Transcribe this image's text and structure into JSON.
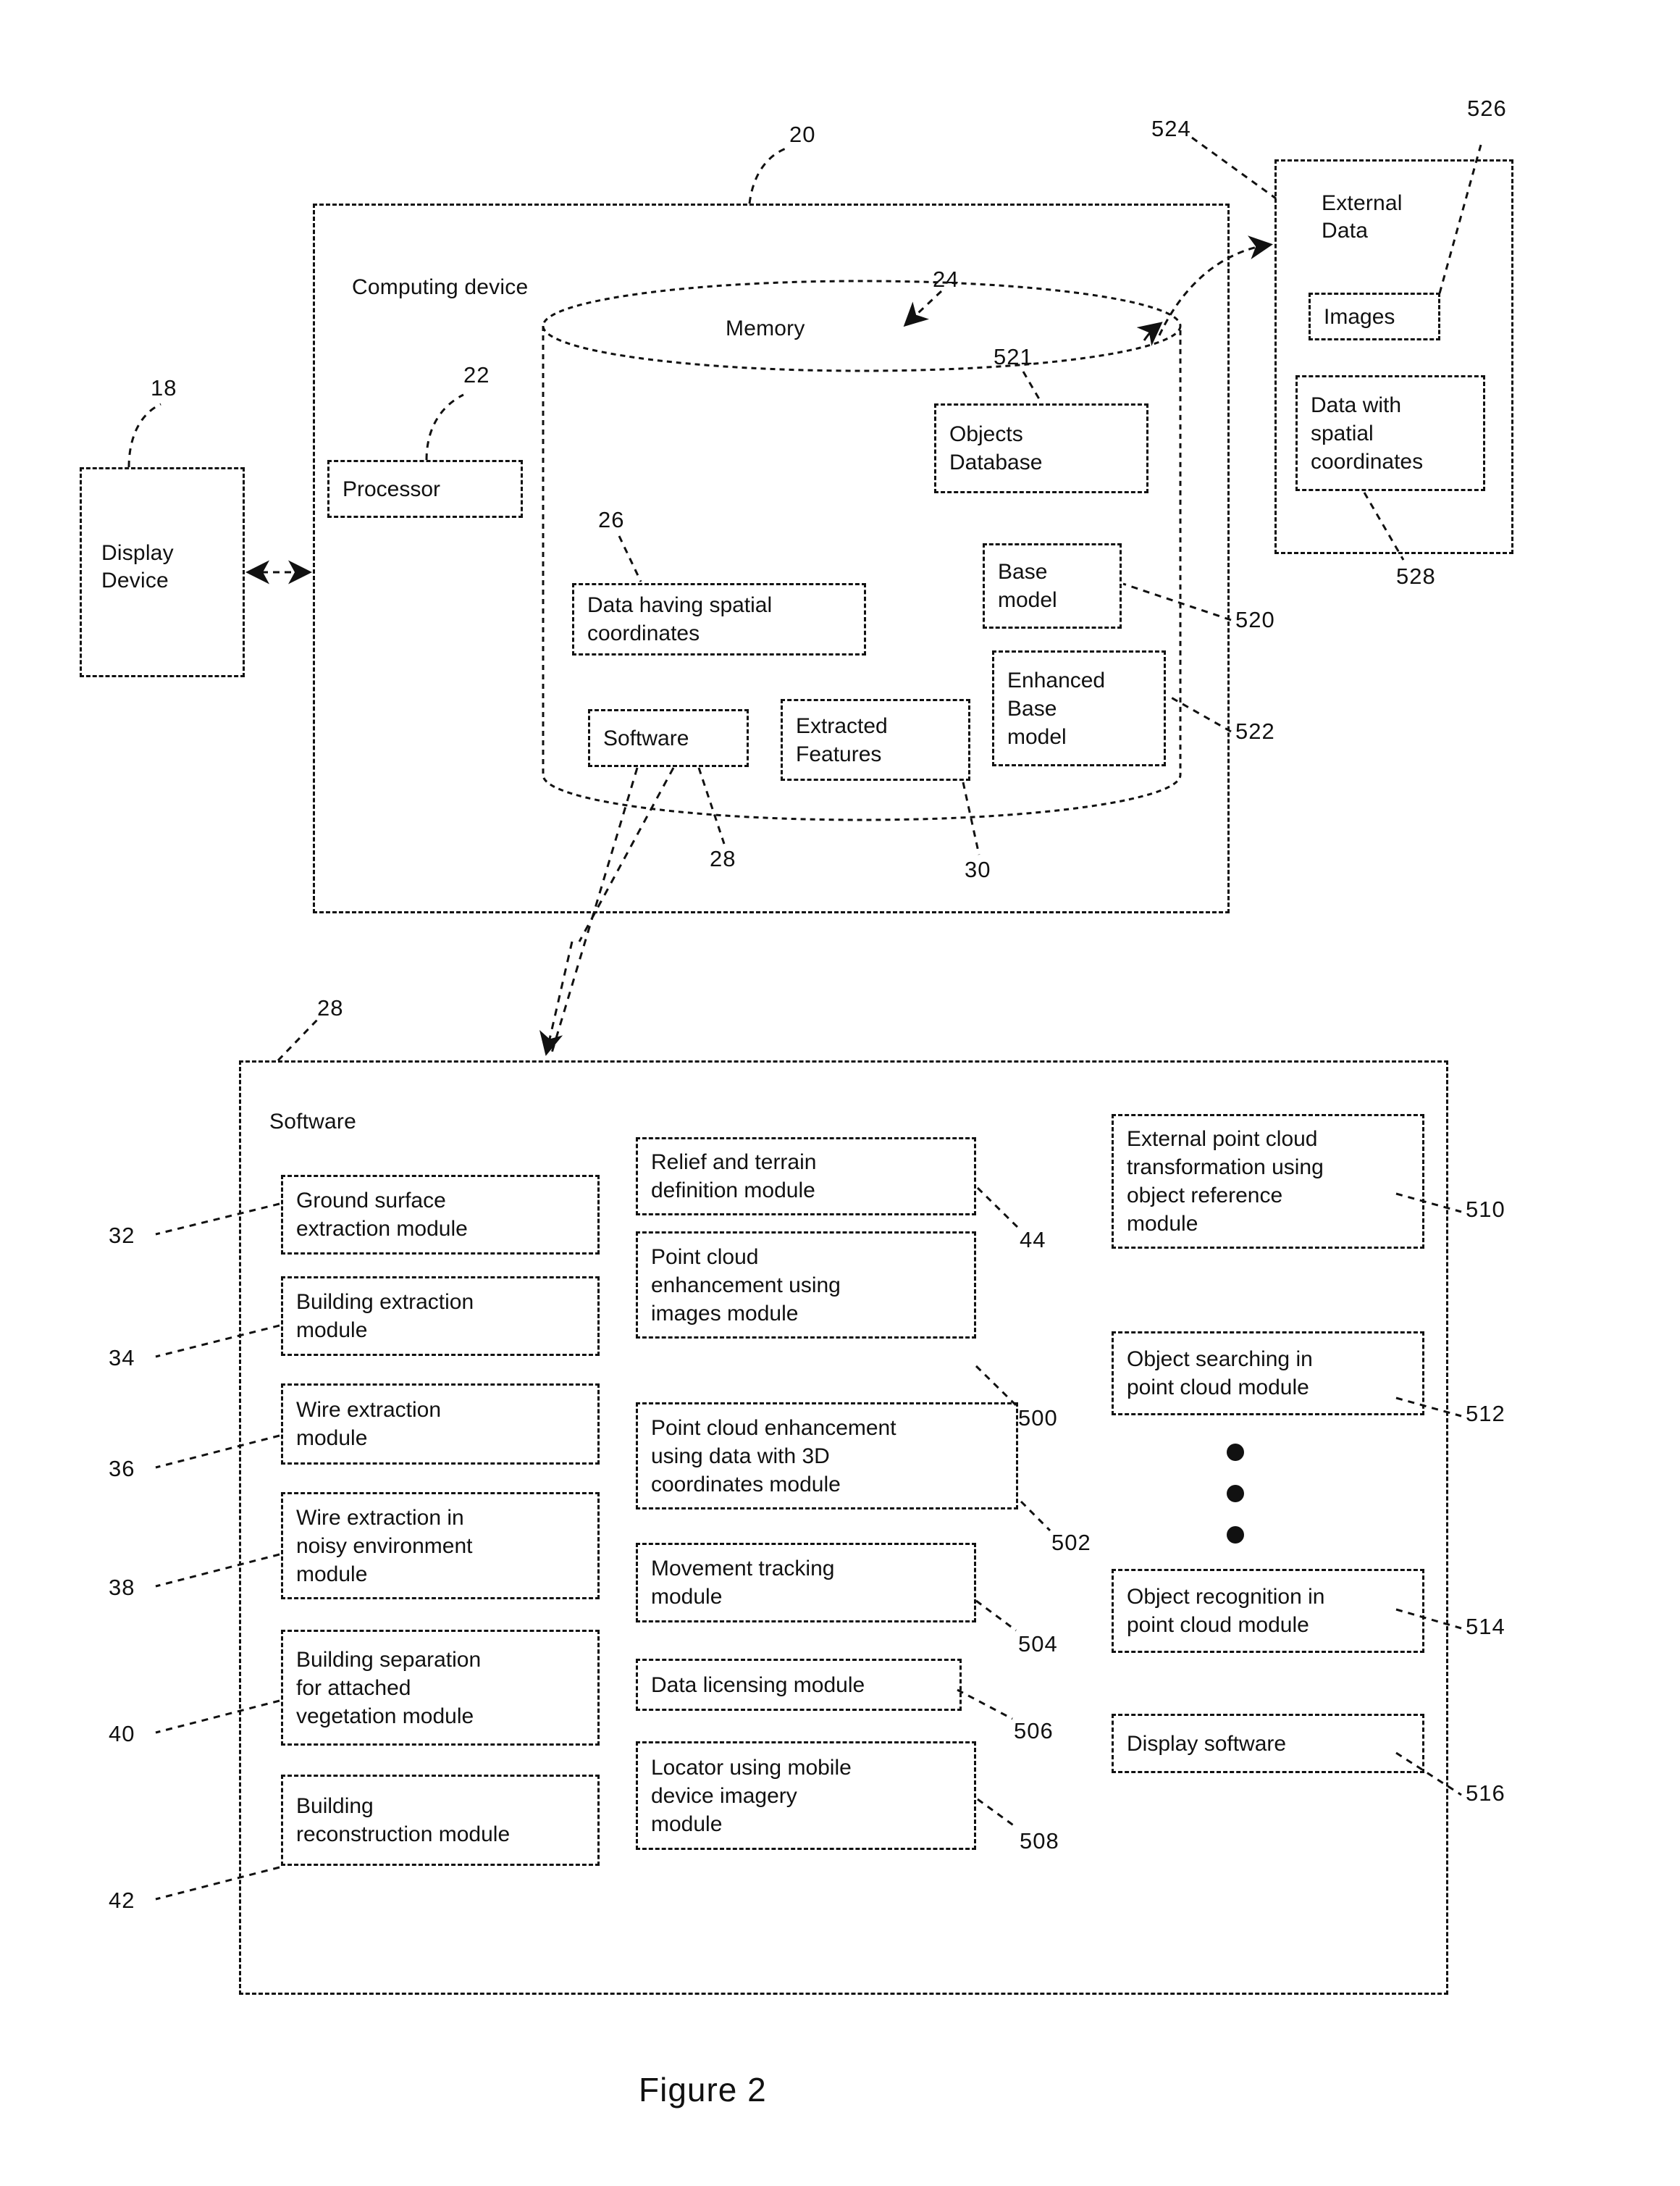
{
  "figure": {
    "caption": "Figure 2"
  },
  "display_device": {
    "label": "Display\nDevice",
    "ref": "18"
  },
  "computing_device": {
    "label": "Computing device",
    "ref": "20",
    "processor": {
      "label": "Processor",
      "ref": "22"
    },
    "memory": {
      "label": "Memory",
      "ref": "24",
      "items": [
        {
          "label": "Objects\nDatabase",
          "ref": "521"
        },
        {
          "label": "Data having spatial\ncoordinates",
          "ref": "26"
        },
        {
          "label": "Base\nmodel",
          "ref": "520"
        },
        {
          "label": "Enhanced\nBase\nmodel",
          "ref": "522"
        },
        {
          "label": "Software",
          "ref": "28"
        },
        {
          "label": "Extracted\nFeatures",
          "ref": "30"
        }
      ]
    }
  },
  "external_data": {
    "label": "External\nData",
    "ref": "524",
    "items": [
      {
        "label": "Images",
        "ref": "526"
      },
      {
        "label": "Data with\nspatial\ncoordinates",
        "ref": "528"
      }
    ]
  },
  "software_panel": {
    "label": "Software",
    "ref": "28",
    "column_left": [
      {
        "label": "Ground surface\nextraction module",
        "ref": "32"
      },
      {
        "label": "Building extraction\nmodule",
        "ref": "34"
      },
      {
        "label": "Wire extraction\nmodule",
        "ref": "36"
      },
      {
        "label": "Wire extraction in\nnoisy environment\nmodule",
        "ref": "38"
      },
      {
        "label": "Building separation\nfor attached\nvegetation module",
        "ref": "40"
      },
      {
        "label": "Building\nreconstruction module",
        "ref": "42"
      }
    ],
    "column_middle": [
      {
        "label": "Relief and terrain\ndefinition module",
        "ref": "44"
      },
      {
        "label": "Point cloud\nenhancement using\nimages module",
        "ref": "500"
      },
      {
        "label": "Point cloud enhancement\nusing data with 3D\ncoordinates module",
        "ref": "502"
      },
      {
        "label": "Movement tracking\nmodule",
        "ref": "504"
      },
      {
        "label": "Data licensing module",
        "ref": "506"
      },
      {
        "label": "Locator using mobile\ndevice imagery\nmodule",
        "ref": "508"
      }
    ],
    "column_right": [
      {
        "label": "External point cloud\ntransformation using\nobject reference\nmodule",
        "ref": "510"
      },
      {
        "label": "Object searching in\npoint cloud module",
        "ref": "512"
      },
      {
        "label": "Object recognition in\npoint cloud module",
        "ref": "514"
      },
      {
        "label": "Display software",
        "ref": "516"
      }
    ],
    "ellipsis": "vertical-ellipsis"
  },
  "colors": {
    "ink": "#111111",
    "background": "#ffffff"
  }
}
